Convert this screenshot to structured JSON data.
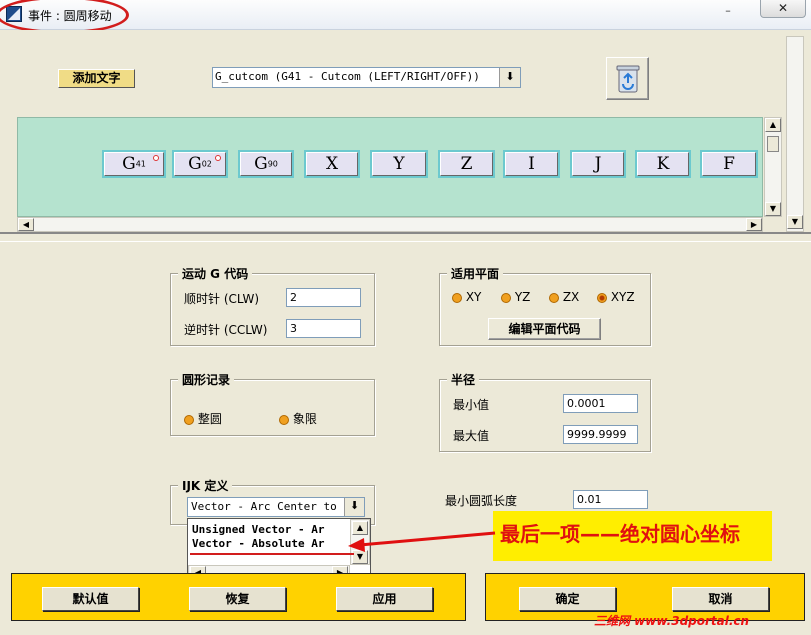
{
  "window": {
    "title": "事件 : 圆周移动",
    "minimize_label": "–",
    "close_label": "✕"
  },
  "top": {
    "add_text_label": "添加文字",
    "gcode_value": "G_cutcom (G41 - Cutcom (LEFT/RIGHT/OFF))",
    "dropdown_arrow": "⬇"
  },
  "gcode_buttons": [
    {
      "main": "G",
      "sub": "41",
      "dot": true
    },
    {
      "main": "G",
      "sub": "02",
      "dot": true
    },
    {
      "main": "G",
      "sub": "90",
      "dot": false
    },
    {
      "main": "X",
      "sub": "",
      "dot": false
    },
    {
      "main": "Y",
      "sub": "",
      "dot": false
    },
    {
      "main": "Z",
      "sub": "",
      "dot": false
    },
    {
      "main": "I",
      "sub": "",
      "dot": false
    },
    {
      "main": "J",
      "sub": "",
      "dot": false
    },
    {
      "main": "K",
      "sub": "",
      "dot": false
    },
    {
      "main": "F",
      "sub": "",
      "dot": false
    }
  ],
  "motion_g": {
    "title": "运动 G 代码",
    "cw_label": "顺时针 (CLW)",
    "cw_value": "2",
    "ccw_label": "逆时针 (CCLW)",
    "ccw_value": "3"
  },
  "plane": {
    "title": "适用平面",
    "options": [
      "XY",
      "YZ",
      "ZX",
      "XYZ"
    ],
    "selected": "XYZ",
    "edit_button": "编辑平面代码"
  },
  "circle_record": {
    "title": "圆形记录",
    "full_label": "整圆",
    "quadrant_label": "象限"
  },
  "radius": {
    "title": "半径",
    "min_label": "最小值",
    "min_value": "0.0001",
    "max_label": "最大值",
    "max_value": "9999.9999"
  },
  "ijk": {
    "title": "IJK 定义",
    "selected": "Vector - Arc Center to",
    "options": [
      "Unsigned Vector - Ar",
      "Vector - Absolute Ar"
    ]
  },
  "min_arc": {
    "label": "最小圆弧长度",
    "value": "0.01"
  },
  "annotation": {
    "text": "最后一项——绝对圆心坐标",
    "color": "#e01010",
    "box_color": "#ffee00"
  },
  "bottom": {
    "default_label": "默认值",
    "restore_label": "恢复",
    "apply_label": "应用",
    "ok_label": "确定",
    "cancel_label": "取消"
  },
  "watermark": "三维网 www.3dportal.cn"
}
